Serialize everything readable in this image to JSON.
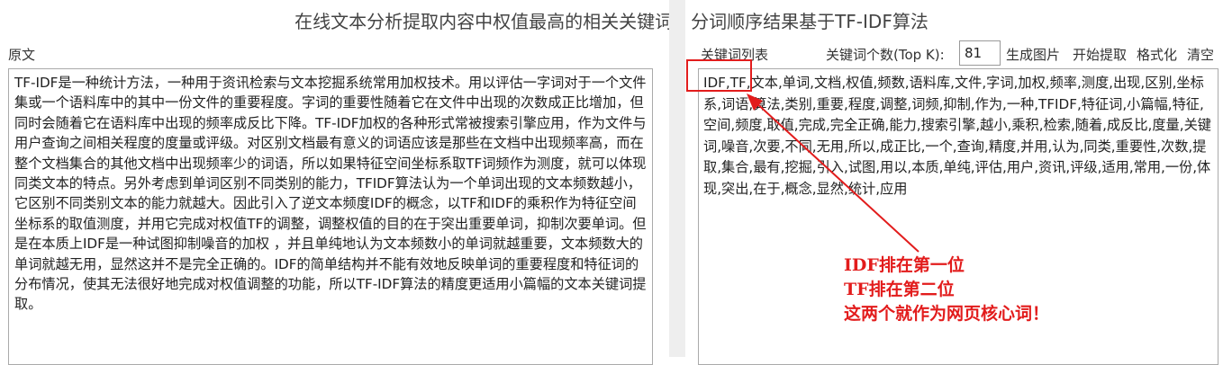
{
  "header": {
    "title": "在线文本分析提取内容中权值最高的相关关键词 - 分词顺序结果基于TF-IDF算法"
  },
  "source_panel": {
    "label": "原文",
    "text": "TF-IDF是一种统计方法，一种用于资讯检索与文本挖掘系统常用加权技术。用以评估一字词对于一个文件集或一个语料库中的其中一份文件的重要程度。字词的重要性随着它在文件中出现的次数成正比增加，但同时会随着它在语料库中出现的频率成反比下降。TF-IDF加权的各种形式常被搜索引擎应用，作为文件与用户查询之间相关程度的度量或评级。对区别文档最有意义的词语应该是那些在文档中出现频率高，而在整个文档集合的其他文档中出现频率少的词语，所以如果特征空间坐标系取TF词频作为测度，就可以体现同类文本的特点。另外考虑到单词区别不同类别的能力，TFIDF算法认为一个单词出现的文本频数越小，它区别不同类别文本的能力就越大。因此引入了逆文本频度IDF的概念，以TF和IDF的乘积作为特征空间坐标系的取值测度，并用它完成对权值TF的调整，调整权值的目的在于突出重要单词，抑制次要单词。但是在本质上IDF是一种试图抑制噪音的加权 ，并且单纯地认为文本频数小的单词就越重要，文本频数大的单词就越无用，显然这并不是完全正确的。IDF的简单结构并不能有效地反映单词的重要程度和特征词的分布情况，使其无法很好地完成对权值调整的功能，所以TF-IDF算法的精度更适用小篇幅的文本关键词提取。"
  },
  "keyword_panel": {
    "label": "关键词列表",
    "topk_label": "关键词个数(Top K):",
    "topk_value": "81",
    "buttons": {
      "generate_image": "生成图片",
      "start_extract": "开始提取",
      "format": "格式化",
      "clear": "清空"
    },
    "keywords": "IDF,TF,文本,单词,文档,权值,频数,语料库,文件,字词,加权,频率,测度,出现,区别,坐标系,词语,算法,类别,重要,程度,调整,词频,抑制,作为,一种,TFIDF,特征词,小篇幅,特征,空间,频度,取值,完成,完全正确,能力,搜索引擎,越小,乘积,检索,随着,成反比,度量,关键词,噪音,次要,不同,无用,所以,成正比,一个,查询,精度,并用,认为,同类,重要性,次数,提取,集合,最有,挖掘,引入,试图,用以,本质,单纯,评估,用户,资讯,评级,适用,常用,一份,体现,突出,在于,概念,显然,统计,应用"
  },
  "annotation": {
    "line1": "IDF排在第一位",
    "line2": "TF排在第二位",
    "line3": "这两个就作为网页核心词！",
    "color": "#e21c1c"
  }
}
